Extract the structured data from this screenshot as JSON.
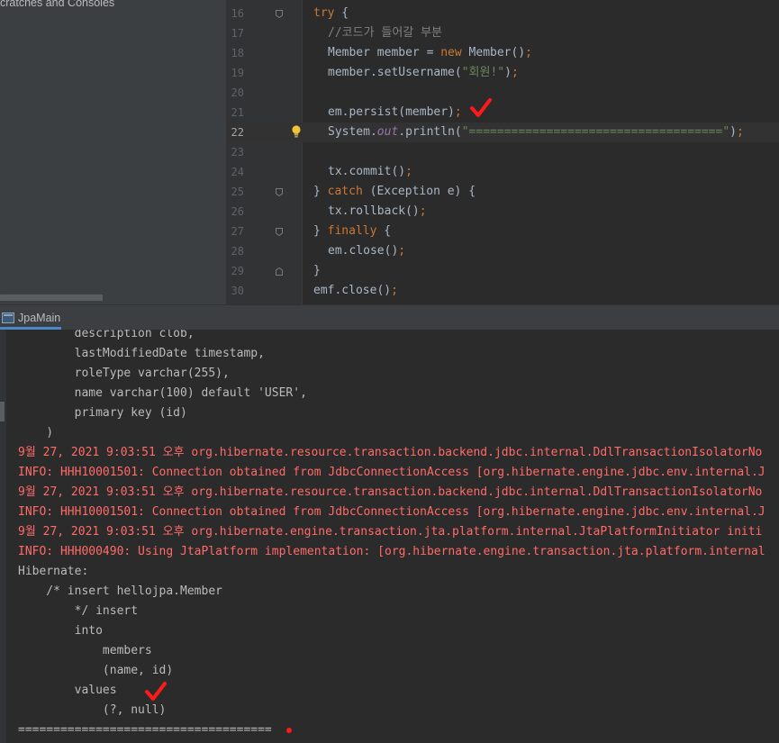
{
  "project_pane": {
    "label": "cratches and Consoles"
  },
  "editor": {
    "current_line_index": 6,
    "lines": [
      {
        "num": "16",
        "tokens": [
          [
            "kw",
            "try"
          ],
          [
            "p",
            " {"
          ]
        ]
      },
      {
        "num": "17",
        "tokens": [
          [
            "cm",
            "//코드가 들어갈 부분"
          ]
        ]
      },
      {
        "num": "18",
        "tokens": [
          [
            "p",
            "Member member = "
          ],
          [
            "kw",
            "new"
          ],
          [
            "p",
            " Member()"
          ],
          [
            "kw",
            ";"
          ]
        ]
      },
      {
        "num": "19",
        "tokens": [
          [
            "p",
            "member.setUsername("
          ],
          [
            "str",
            "\"회원!\""
          ],
          [
            "p",
            ")"
          ],
          [
            "kw",
            ";"
          ]
        ]
      },
      {
        "num": "20",
        "tokens": []
      },
      {
        "num": "21",
        "tokens": [
          [
            "p",
            "em.persist(member)"
          ],
          [
            "kw",
            ";"
          ]
        ]
      },
      {
        "num": "22",
        "tokens": [
          [
            "p",
            "System."
          ],
          [
            "st",
            "out"
          ],
          [
            "p",
            ".println("
          ],
          [
            "str",
            "\"====================================\""
          ],
          [
            "p",
            ")"
          ],
          [
            "kw",
            ";"
          ]
        ]
      },
      {
        "num": "23",
        "tokens": []
      },
      {
        "num": "24",
        "tokens": [
          [
            "p",
            "tx.commit()"
          ],
          [
            "kw",
            ";"
          ]
        ]
      },
      {
        "num": "25",
        "tokens": [
          [
            "p",
            "} "
          ],
          [
            "kw",
            "catch"
          ],
          [
            "p",
            " (Exception e) {"
          ]
        ]
      },
      {
        "num": "26",
        "tokens": [
          [
            "p",
            "tx.rollback()"
          ],
          [
            "kw",
            ";"
          ]
        ]
      },
      {
        "num": "27",
        "tokens": [
          [
            "p",
            "} "
          ],
          [
            "kw",
            "finally"
          ],
          [
            "p",
            " {"
          ]
        ]
      },
      {
        "num": "28",
        "tokens": [
          [
            "p",
            "em.close()"
          ],
          [
            "kw",
            ";"
          ]
        ]
      },
      {
        "num": "29",
        "tokens": [
          [
            "p",
            "}"
          ]
        ]
      },
      {
        "num": "30",
        "tokens": [
          [
            "p",
            "emf.close()"
          ],
          [
            "kw",
            ";"
          ]
        ]
      }
    ]
  },
  "console": {
    "tab_label": "JpaMain",
    "lines": [
      {
        "text": "        description clob,",
        "kind": "out"
      },
      {
        "text": "        lastModifiedDate timestamp,",
        "kind": "out"
      },
      {
        "text": "        roleType varchar(255),",
        "kind": "out"
      },
      {
        "text": "        name varchar(100) default 'USER',",
        "kind": "out"
      },
      {
        "text": "        primary key (id)",
        "kind": "out"
      },
      {
        "text": "    )",
        "kind": "out"
      },
      {
        "text": "9월 27, 2021 9:03:51 오후 org.hibernate.resource.transaction.backend.jdbc.internal.DdlTransactionIsolatorNo",
        "kind": "err"
      },
      {
        "text": "INFO: HHH10001501: Connection obtained from JdbcConnectionAccess [org.hibernate.engine.jdbc.env.internal.J",
        "kind": "err"
      },
      {
        "text": "9월 27, 2021 9:03:51 오후 org.hibernate.resource.transaction.backend.jdbc.internal.DdlTransactionIsolatorNo",
        "kind": "err"
      },
      {
        "text": "INFO: HHH10001501: Connection obtained from JdbcConnectionAccess [org.hibernate.engine.jdbc.env.internal.J",
        "kind": "err"
      },
      {
        "text": "9월 27, 2021 9:03:51 오후 org.hibernate.engine.transaction.jta.platform.internal.JtaPlatformInitiator initi",
        "kind": "err"
      },
      {
        "text": "INFO: HHH000490: Using JtaPlatform implementation: [org.hibernate.engine.transaction.jta.platform.internal",
        "kind": "err"
      },
      {
        "text": "Hibernate:",
        "kind": "out"
      },
      {
        "text": "    /* insert hellojpa.Member",
        "kind": "out"
      },
      {
        "text": "        */ insert",
        "kind": "out"
      },
      {
        "text": "        into",
        "kind": "out"
      },
      {
        "text": "            members",
        "kind": "out"
      },
      {
        "text": "            (name, id)",
        "kind": "out"
      },
      {
        "text": "        values",
        "kind": "out"
      },
      {
        "text": "            (?, null)",
        "kind": "out"
      },
      {
        "text": "====================================",
        "kind": "out"
      }
    ]
  },
  "annotations": {
    "mark_color": "#ff1a1a"
  }
}
